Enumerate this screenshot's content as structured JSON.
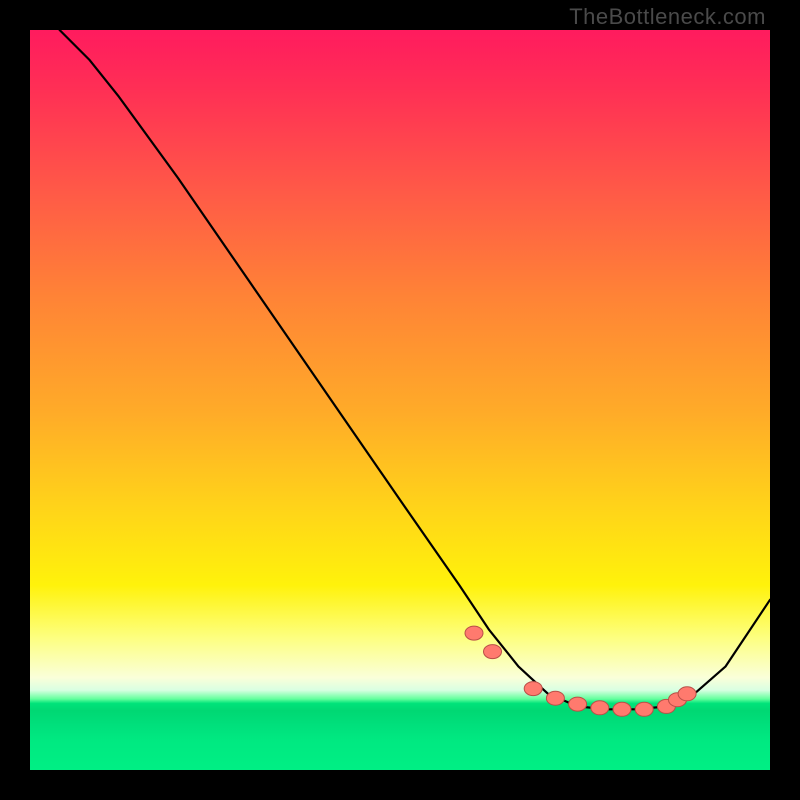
{
  "watermark": "TheBottleneck.com",
  "chart_data": {
    "type": "line",
    "title": "",
    "xlabel": "",
    "ylabel": "",
    "xlim": [
      0,
      100
    ],
    "ylim": [
      0,
      100
    ],
    "grid": false,
    "legend": false,
    "series": [
      {
        "name": "curve",
        "x": [
          4,
          8,
          12,
          20,
          30,
          40,
          50,
          58,
          62,
          66,
          70,
          74,
          78,
          82,
          86,
          90,
          94,
          100
        ],
        "y": [
          100,
          96,
          91,
          80,
          65.5,
          51,
          36.5,
          25,
          19,
          14,
          10.3,
          8.6,
          8.2,
          8.2,
          8.6,
          10.5,
          14,
          23
        ]
      }
    ],
    "markers": {
      "name": "highlight-points",
      "x": [
        60,
        62.5,
        68,
        71,
        74,
        77,
        80,
        83,
        86,
        87.5,
        88.8
      ],
      "y": [
        18.5,
        16,
        11,
        9.7,
        8.9,
        8.4,
        8.2,
        8.2,
        8.6,
        9.5,
        10.3
      ]
    }
  }
}
